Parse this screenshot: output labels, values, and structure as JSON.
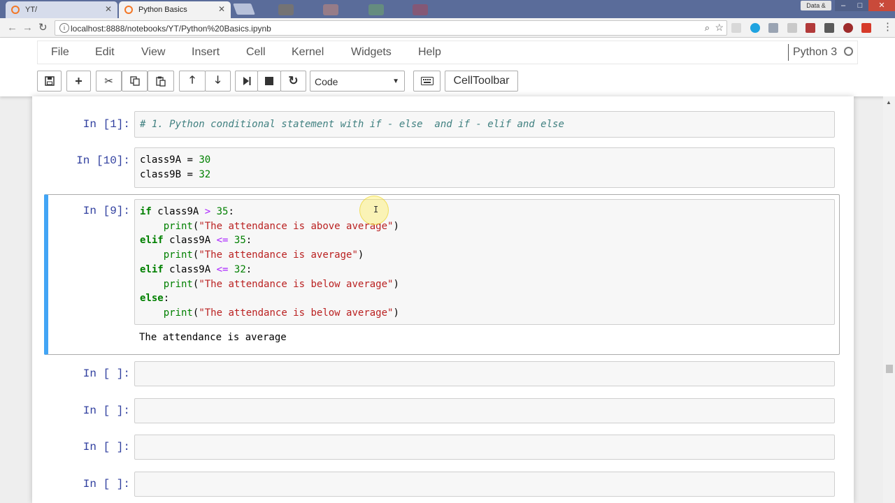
{
  "browser": {
    "tabs": [
      {
        "label": "YT/",
        "active": false
      },
      {
        "label": "Python Basics",
        "active": true
      }
    ],
    "window_user": "Data &",
    "url": "localhost:8888/notebooks/YT/Python%20Basics.ipynb"
  },
  "jupyter": {
    "menu": [
      "File",
      "Edit",
      "View",
      "Insert",
      "Cell",
      "Kernel",
      "Widgets",
      "Help"
    ],
    "kernel_name": "Python 3",
    "cell_type_selected": "Code",
    "celltoolbar_label": "CellToolbar"
  },
  "cells": [
    {
      "prompt": "In [1]:"
    },
    {
      "prompt": "In [10]:"
    },
    {
      "prompt": "In [9]:",
      "output": "The attendance is average"
    },
    {
      "prompt": "In [ ]:"
    },
    {
      "prompt": "In [ ]:"
    },
    {
      "prompt": "In [ ]:"
    },
    {
      "prompt": "In [ ]:"
    }
  ],
  "code": {
    "cell1": {
      "comment": "# 1. Python conditional statement with if - else  and if - elif and else"
    },
    "cell2": {
      "var_a": "class9A",
      "var_b": "class9B",
      "eq": " = ",
      "val_a": "30",
      "val_b": "32"
    },
    "cell3": {
      "kw_if": "if",
      "kw_elif": "elif",
      "kw_else": "else",
      "var": "class9A",
      "op_gt": ">",
      "op_le": "<=",
      "n35": "35",
      "n32": "32",
      "colon": ":",
      "indent": "    ",
      "print": "print",
      "paren_open": "(",
      "paren_close": ")",
      "str_above": "\"The attendance is above average\"",
      "str_avg": "\"The attendance is average\"",
      "str_below": "\"The attendance is below average\""
    }
  }
}
